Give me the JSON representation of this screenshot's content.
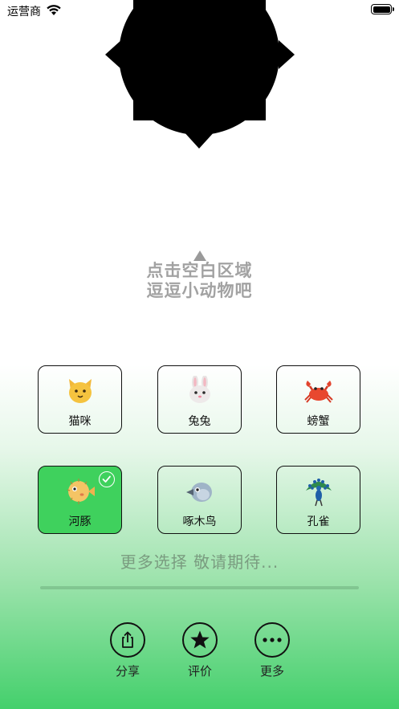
{
  "status_bar": {
    "carrier": "运营商",
    "wifi_icon": "wifi-icon",
    "battery_icon": "battery-icon"
  },
  "hint": {
    "arrow_icon": "up-arrow-icon",
    "line1": "点击空白区域",
    "line2": "逗逗小动物吧"
  },
  "animals": [
    {
      "label": "猫咪",
      "emoji": "cat-face-icon",
      "selected": false
    },
    {
      "label": "兔兔",
      "emoji": "rabbit-face-icon",
      "selected": false
    },
    {
      "label": "螃蟹",
      "emoji": "crab-icon",
      "selected": false
    },
    {
      "label": "河豚",
      "emoji": "blowfish-icon",
      "selected": true
    },
    {
      "label": "啄木鸟",
      "emoji": "bird-icon",
      "selected": false
    },
    {
      "label": "孔雀",
      "emoji": "peacock-icon",
      "selected": false
    }
  ],
  "more_text": "更多选择 敬请期待...",
  "actions": {
    "share": "分享",
    "rate": "评价",
    "more": "更多"
  },
  "colors": {
    "selected": "#3fd15d",
    "hint_text": "#a2a2a2",
    "more_text": "#7a9c80"
  }
}
